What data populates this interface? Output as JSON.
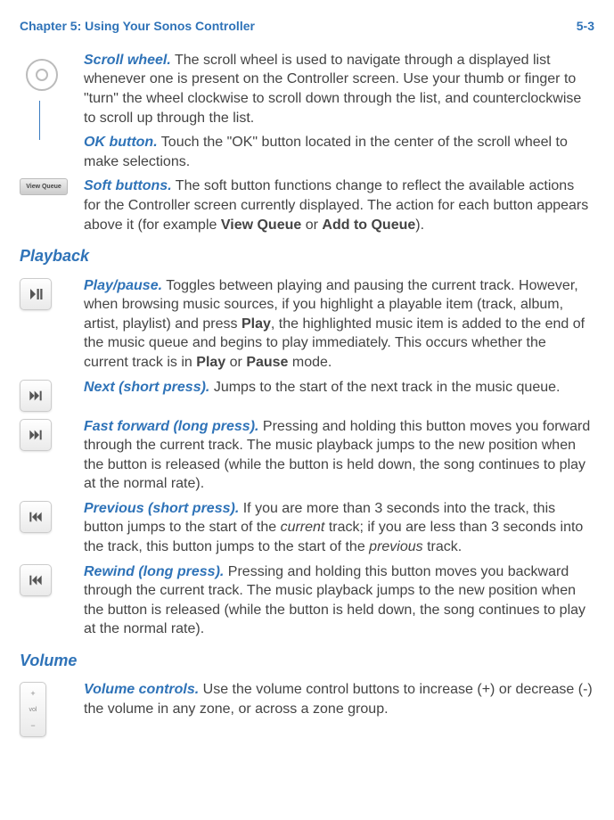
{
  "header": {
    "chapter": "Chapter 5:  Using Your Sonos Controller",
    "page": "5-3"
  },
  "controls": {
    "scroll_wheel": {
      "term": "Scroll wheel.",
      "desc": " The scroll wheel is used to navigate through a displayed list whenever one is present on the Controller screen. Use your thumb or finger to \"turn\" the wheel clockwise to scroll down through the list, and counterclockwise to scroll up through the list."
    },
    "ok_button": {
      "term": "OK button.",
      "desc": " Touch the \"OK\" button located in the center of the scroll wheel to make selections."
    },
    "soft_buttons": {
      "icon_label": "View Queue",
      "term": "Soft buttons.",
      "pre": " The soft button functions change to reflect the available actions for the Controller screen currently displayed. The action for each button appears above it (for example ",
      "b1": "View Queue",
      "mid": " or ",
      "b2": "Add to Queue",
      "post": ")."
    }
  },
  "playback": {
    "heading": "Playback",
    "play_pause": {
      "term": "Play/pause.",
      "a": " Toggles between playing and pausing the current track. However, when browsing music sources, if you highlight a playable item (track, album, artist, playlist) and press ",
      "b1": "Play",
      "b": ", the highlighted music item is added to the end of the music queue and begins to play immediately. This occurs whether the current track is in ",
      "b2": "Play",
      "c": " or ",
      "b3": "Pause",
      "d": " mode."
    },
    "next": {
      "term": "Next (short press).",
      "desc": " Jumps to the start of the next track in the music queue."
    },
    "ffwd": {
      "term": "Fast forward (long press).",
      "desc": " Pressing and holding this button moves you forward through the current track. The music playback jumps to the new position when the button is released (while the button is held down, the song continues to play at the normal rate)."
    },
    "prev": {
      "term": "Previous (short press).",
      "a": " If you are more than 3 seconds into the track, this button jumps to the start of the ",
      "i1": "current",
      "b": " track; if you are less than 3 seconds into the track, this button jumps to the start of the ",
      "i2": "previous",
      "c": " track."
    },
    "rew": {
      "term": "Rewind (long press).",
      "desc": "  Pressing and holding this button moves you backward through the current track. The music playback jumps to the new position when the button is released (while the button is held down, the song continues to play at the normal rate)."
    }
  },
  "volume": {
    "heading": "Volume",
    "controls": {
      "term": "Volume controls.",
      "desc": " Use the volume control buttons to increase (+) or decrease (-) the volume in any zone, or across a zone group.",
      "plus": "+",
      "label": "vol",
      "minus": "−"
    }
  }
}
